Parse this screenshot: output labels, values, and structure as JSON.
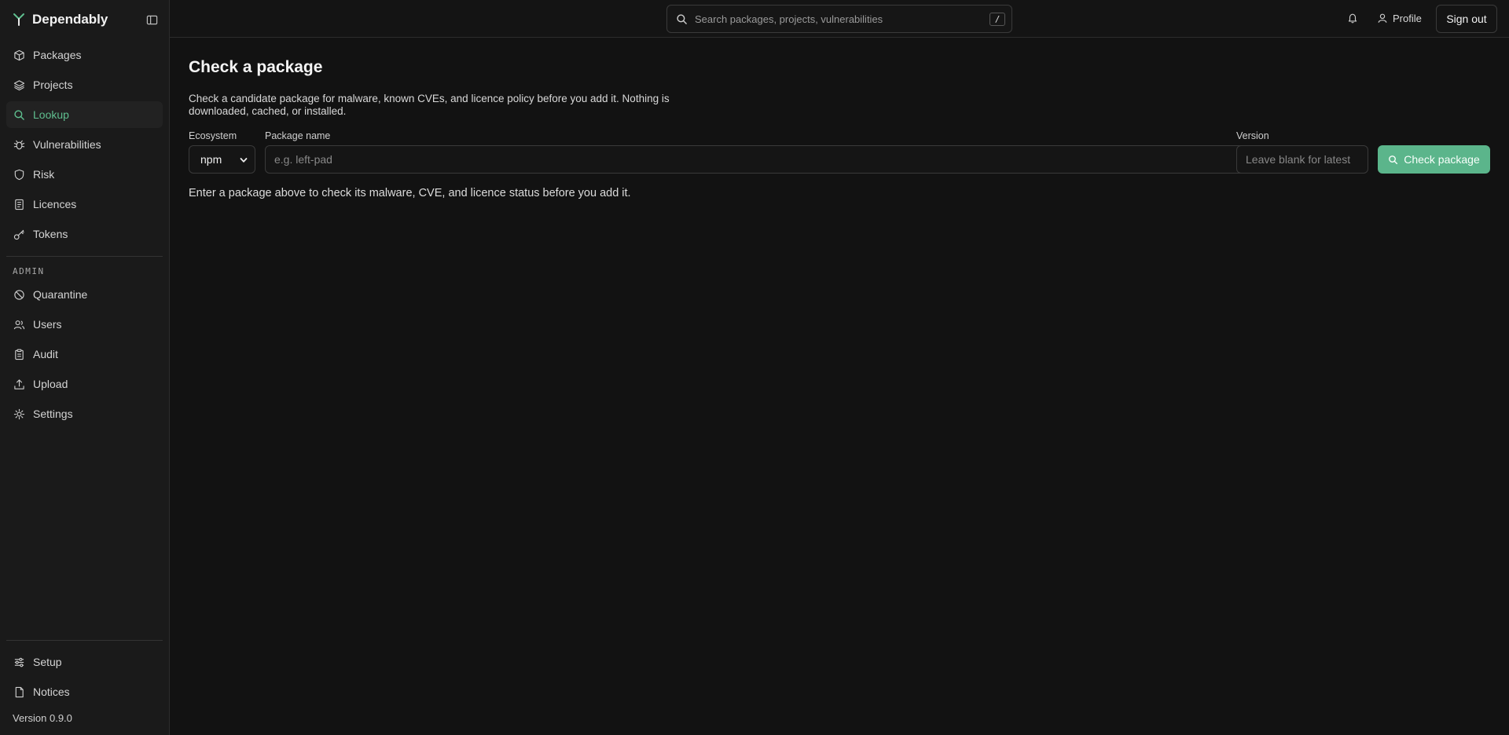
{
  "app": {
    "name": "Dependably",
    "version_text": "Version 0.9.0",
    "accent_color": "#5bb58b"
  },
  "sidebar": {
    "collapse_icon": "sidebar-toggle-icon",
    "items": [
      {
        "label": "Packages",
        "icon": "package-icon",
        "active": false
      },
      {
        "label": "Projects",
        "icon": "layers-icon",
        "active": false
      },
      {
        "label": "Lookup",
        "icon": "search-icon",
        "active": true
      },
      {
        "label": "Vulnerabilities",
        "icon": "bug-icon",
        "active": false
      },
      {
        "label": "Risk",
        "icon": "shield-icon",
        "active": false
      },
      {
        "label": "Licences",
        "icon": "document-icon",
        "active": false
      },
      {
        "label": "Tokens",
        "icon": "key-icon",
        "active": false
      }
    ],
    "admin_label": "ADMIN",
    "admin_items": [
      {
        "label": "Quarantine",
        "icon": "ban-icon"
      },
      {
        "label": "Users",
        "icon": "users-icon"
      },
      {
        "label": "Audit",
        "icon": "clipboard-icon"
      },
      {
        "label": "Upload",
        "icon": "upload-icon"
      },
      {
        "label": "Settings",
        "icon": "gear-icon"
      }
    ],
    "footer_items": [
      {
        "label": "Setup",
        "icon": "sliders-icon"
      },
      {
        "label": "Notices",
        "icon": "file-icon"
      }
    ]
  },
  "topbar": {
    "search_placeholder": "Search packages, projects, vulnerabilities",
    "search_shortcut": "/",
    "profile_label": "Profile",
    "signout_label": "Sign out"
  },
  "main": {
    "title": "Check a package",
    "description": "Check a candidate package for malware, known CVEs, and licence policy before you add it. Nothing is downloaded, cached, or installed.",
    "form": {
      "ecosystem_label": "Ecosystem",
      "ecosystem_value": "npm",
      "package_label": "Package name",
      "package_placeholder": "e.g. left-pad",
      "version_label": "Version",
      "version_placeholder": "Leave blank for latest",
      "submit_label": "Check package"
    },
    "hint": "Enter a package above to check its malware, CVE, and licence status before you add it."
  }
}
